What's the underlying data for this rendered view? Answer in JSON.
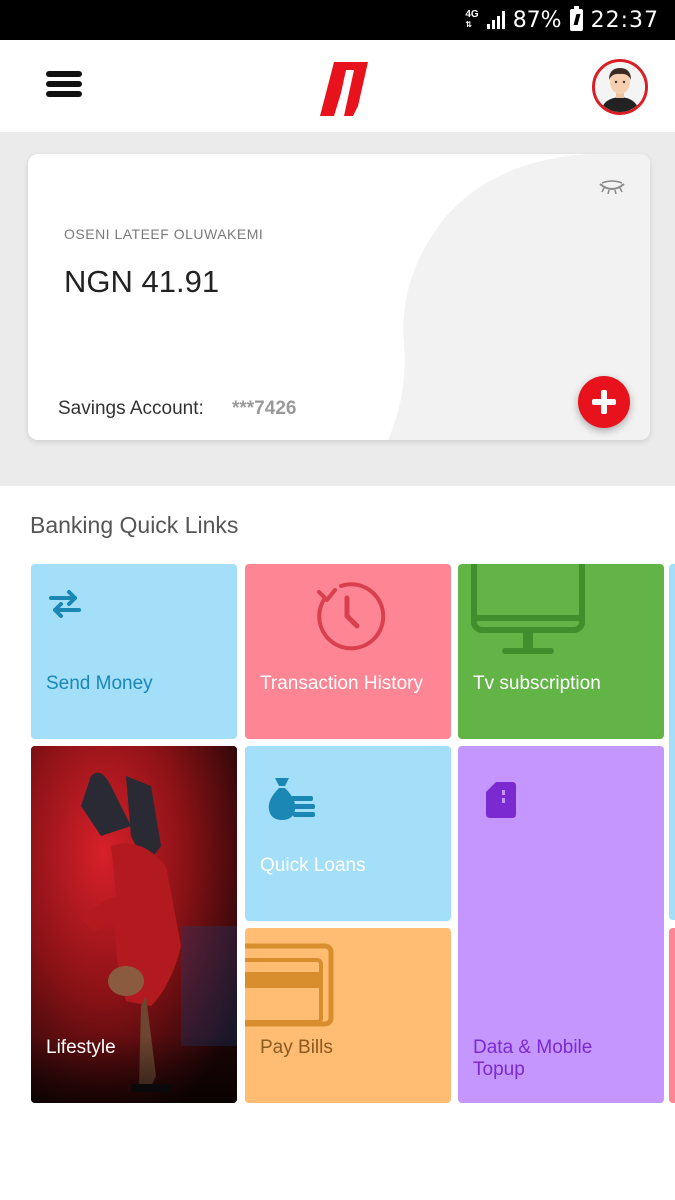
{
  "status_bar": {
    "network": "4G",
    "battery": "87%",
    "time": "22:37"
  },
  "header": {
    "logo": "bank-logo",
    "avatar": "user-avatar"
  },
  "account": {
    "holder_name": "OSENI LATEEF OLUWAKEMI",
    "balance": "NGN 41.91",
    "account_type": "Savings Account:",
    "account_number": "***7426"
  },
  "quick_links": {
    "title": "Banking Quick Links",
    "tiles": [
      {
        "label": "Send Money",
        "icon": "transfer-arrows-icon",
        "color": "#a4dffa",
        "text_color": "#1a87b5"
      },
      {
        "label": "Transaction History",
        "icon": "clock-history-icon",
        "color": "#fd8594",
        "text_color": "#ffffff"
      },
      {
        "label": "Tv subscription",
        "icon": "tv-monitor-icon",
        "color": "#62b447",
        "text_color": "#ffffff"
      },
      {
        "label": "Lifestyle",
        "icon": "lifestyle-photo",
        "color": "#3a0b0b",
        "text_color": "#ffffff"
      },
      {
        "label": "Quick Loans",
        "icon": "money-bag-icon",
        "color": "#a4dffa",
        "text_color": "#ffffff"
      },
      {
        "label": "Pay Bills",
        "icon": "credit-card-icon",
        "color": "#ffbd73",
        "text_color": "#8a5a1f"
      },
      {
        "label": "Data & Mobile Topup",
        "icon": "sim-card-icon",
        "color": "#c597fe",
        "text_color": "#7a2ad0"
      }
    ]
  },
  "colors": {
    "brand_red": "#e8121c",
    "card_bg": "#ffffff",
    "section_bg": "#ebebeb"
  }
}
